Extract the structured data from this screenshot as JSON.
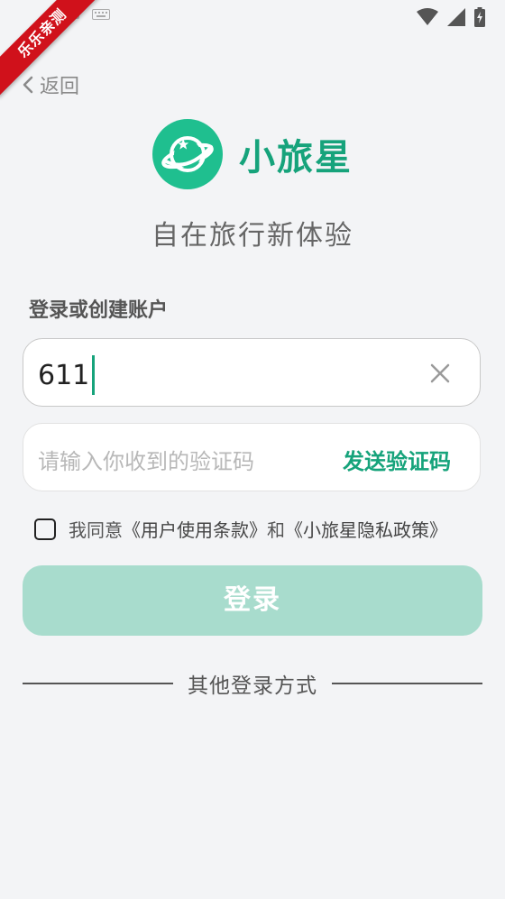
{
  "status_bar": {
    "icons": [
      "image-icon",
      "keyboard-icon",
      "wifi-icon",
      "signal-icon",
      "battery-icon"
    ]
  },
  "ribbon": {
    "text": "乐乐亲测"
  },
  "nav": {
    "back_label": "返回"
  },
  "brand": {
    "name": "小旅星",
    "color": "#16a37b",
    "logo_color": "#1fbf8f"
  },
  "slogan": "自在旅行新体验",
  "form": {
    "section_label": "登录或创建账户",
    "phone_value": "611",
    "code_placeholder": "请输入你收到的验证码",
    "send_code_label": "发送验证码",
    "agreement": {
      "prefix": "我同意",
      "terms": "《用户使用条款》",
      "and": "和",
      "privacy": "《小旅星隐私政策》",
      "checked": false
    },
    "login_label": "登录",
    "login_enabled": false
  },
  "other_login": {
    "label": "其他登录方式"
  }
}
